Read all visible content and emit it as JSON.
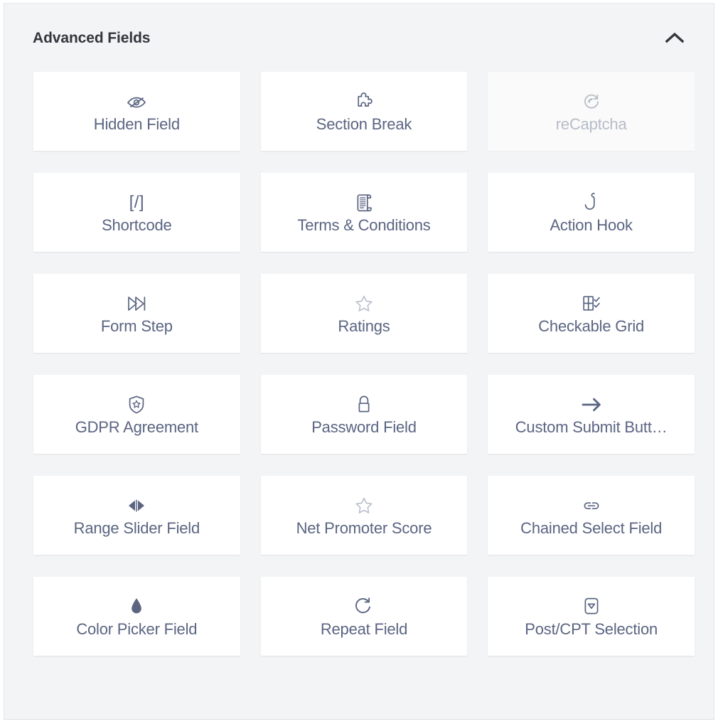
{
  "panel": {
    "title": "Advanced Fields",
    "collapse_icon": "chevron-up-icon",
    "collapse_title": "Collapse section"
  },
  "fields": [
    {
      "label": "Hidden Field",
      "icon": "eye-slash-icon",
      "disabled": false
    },
    {
      "label": "Section Break",
      "icon": "puzzle-piece-icon",
      "disabled": false
    },
    {
      "label": "reCaptcha",
      "icon": "recaptcha-icon",
      "disabled": true
    },
    {
      "label": "Shortcode",
      "icon": "shortcode-brackets",
      "disabled": false,
      "icon_text": "[/]"
    },
    {
      "label": "Terms & Conditions",
      "icon": "scroll-document-icon",
      "disabled": false
    },
    {
      "label": "Action Hook",
      "icon": "fishing-hook-icon",
      "disabled": false
    },
    {
      "label": "Form Step",
      "icon": "fast-forward-icon",
      "disabled": false
    },
    {
      "label": "Ratings",
      "icon": "star-outline-icon",
      "disabled": false
    },
    {
      "label": "Checkable Grid",
      "icon": "checkable-grid-icon",
      "disabled": false
    },
    {
      "label": "GDPR Agreement",
      "icon": "shield-star-icon",
      "disabled": false
    },
    {
      "label": "Password Field",
      "icon": "padlock-icon",
      "disabled": false
    },
    {
      "label": "Custom Submit Butt…",
      "icon": "arrow-right-icon",
      "disabled": false
    },
    {
      "label": "Range Slider Field",
      "icon": "left-right-arrows-icon",
      "disabled": false
    },
    {
      "label": "Net Promoter Score",
      "icon": "star-outline-icon",
      "disabled": false
    },
    {
      "label": "Chained Select Field",
      "icon": "chain-link-icon",
      "disabled": false
    },
    {
      "label": "Color Picker Field",
      "icon": "droplet-icon",
      "disabled": false
    },
    {
      "label": "Repeat Field",
      "icon": "refresh-rotate-icon",
      "disabled": false
    },
    {
      "label": "Post/CPT Selection",
      "icon": "dropdown-box-icon",
      "disabled": false
    }
  ],
  "colors": {
    "panel_background": "#f3f4f5",
    "card_background": "#ffffff",
    "card_disabled_background": "#fafafa",
    "title_text": "#32373c",
    "label_text": "#5b6582",
    "label_disabled_text": "#b6bcc8"
  }
}
